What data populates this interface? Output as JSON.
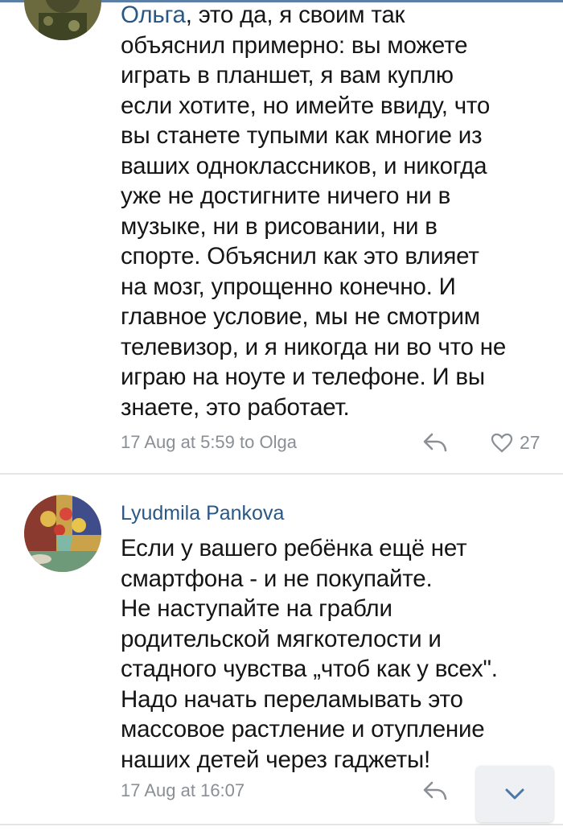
{
  "comments": [
    {
      "author": "Ольга",
      "text_lines": [
        ", это да, я своим так",
        "объяснил примерно: вы можете",
        "играть в планшет, я вам куплю",
        "если хотите, но имейте ввиду, что",
        "вы станете тупыми как многие из",
        "ваших одноклассников, и никогда",
        "уже не достигните ничего ни в",
        "музыке, ни в рисовании, ни в",
        "спорте. Объяснил как это влияет",
        "на мозг, упрощенно конечно. И",
        "главное условие, мы не смотрим",
        "телевизор, и я никогда ни во что не",
        "играю на ноуте и телефоне. И вы",
        "знаете, это работает."
      ],
      "timestamp": "17 Aug at 5:59 to Olga",
      "likes": "27",
      "icons": {
        "reply": "reply-icon",
        "like": "heart-icon"
      }
    },
    {
      "author": "Lyudmila Pankova",
      "text_lines": [
        "Если у вашего ребёнка ещё нет",
        "смартфона - и не покупайте.",
        "Не наступайте на грабли",
        "родительской мягкотелости и",
        "стадного чувства „чтоб как у всех\".",
        "Надо начать переламывать это",
        "массовое растление и отупление",
        "наших детей через гаджеты!"
      ],
      "timestamp": "17 Aug at 16:07",
      "icons": {
        "reply": "reply-icon"
      }
    }
  ],
  "scroll_button": {
    "icon": "chevron-down-icon"
  },
  "colors": {
    "link": "#2a5885",
    "meta": "#8a8f95",
    "text": "#151515",
    "divider": "#e3e5e8",
    "top_bar": "#5b7fa6"
  }
}
